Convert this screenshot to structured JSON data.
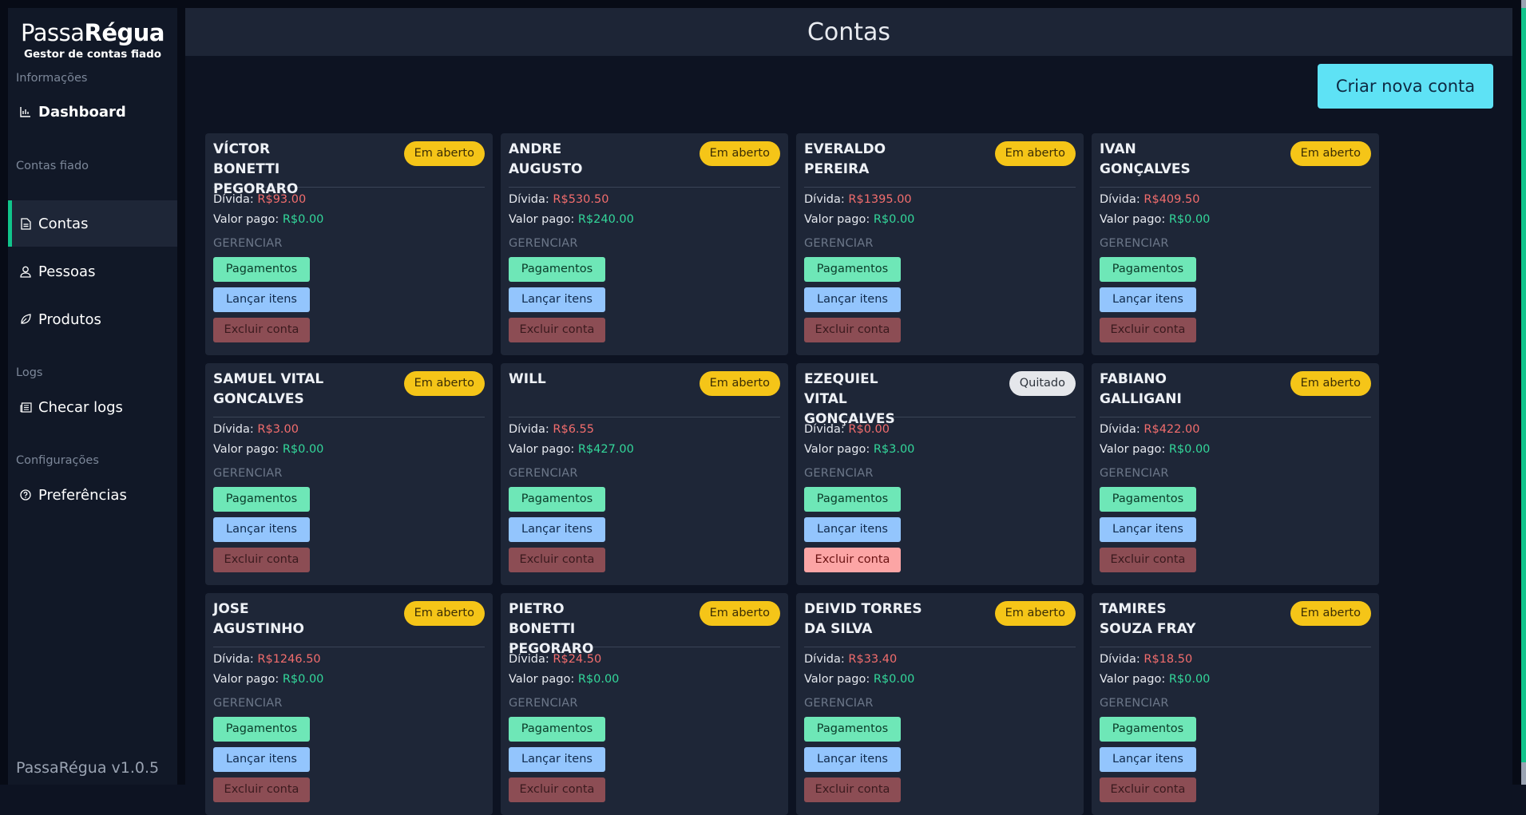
{
  "brand": {
    "title_light": "Passa",
    "title_bold": "Régua",
    "subtitle": "Gestor de contas fiado"
  },
  "sidebar": {
    "sections": [
      {
        "label": "Informações"
      },
      {
        "label": "Contas fiado"
      },
      {
        "label": "Logs"
      },
      {
        "label": "Configurações"
      }
    ],
    "items": [
      {
        "label": "Dashboard",
        "icon": "chart-icon"
      },
      {
        "label": "Contas",
        "icon": "document-icon"
      },
      {
        "label": "Pessoas",
        "icon": "user-icon"
      },
      {
        "label": "Produtos",
        "icon": "leaf-icon"
      },
      {
        "label": "Checar logs",
        "icon": "newspaper-icon"
      },
      {
        "label": "Preferências",
        "icon": "help-circle-icon"
      }
    ],
    "active": "Contas",
    "version": "PassaRégua v1.0.5"
  },
  "header": {
    "title": "Contas"
  },
  "toolbar": {
    "create_label": "Criar nova conta"
  },
  "labels": {
    "debt": "Dívida: ",
    "paid": "Valor pago: ",
    "manage": "GERENCIAR",
    "payments": "Pagamentos",
    "add_items": "Lançar itens",
    "delete": "Excluir conta"
  },
  "accounts": [
    {
      "name": "VÍCTOR BONETTI PEGORARO",
      "status": "Em aberto",
      "debt": "R$93.00",
      "paid": "R$0.00"
    },
    {
      "name": "ANDRE AUGUSTO",
      "status": "Em aberto",
      "debt": "R$530.50",
      "paid": "R$240.00"
    },
    {
      "name": "EVERALDO PEREIRA",
      "status": "Em aberto",
      "debt": "R$1395.00",
      "paid": "R$0.00"
    },
    {
      "name": "IVAN GONÇALVES",
      "status": "Em aberto",
      "debt": "R$409.50",
      "paid": "R$0.00"
    },
    {
      "name": "SAMUEL VITAL GONCALVES",
      "status": "Em aberto",
      "debt": "R$3.00",
      "paid": "R$0.00"
    },
    {
      "name": "WILL",
      "status": "Em aberto",
      "debt": "R$6.55",
      "paid": "R$427.00"
    },
    {
      "name": "EZEQUIEL VITAL GONÇALVES",
      "status": "Quitado",
      "debt": "R$0.00",
      "paid": "R$3.00"
    },
    {
      "name": "FABIANO GALLIGANI",
      "status": "Em aberto",
      "debt": "R$422.00",
      "paid": "R$0.00"
    },
    {
      "name": "JOSE AGUSTINHO",
      "status": "Em aberto",
      "debt": "R$1246.50",
      "paid": "R$0.00"
    },
    {
      "name": "PIETRO BONETTI PEGORARO",
      "status": "Em aberto",
      "debt": "R$24.50",
      "paid": "R$0.00"
    },
    {
      "name": "DEIVID TORRES DA SILVA",
      "status": "Em aberto",
      "debt": "R$33.40",
      "paid": "R$0.00"
    },
    {
      "name": "TAMIRES SOUZA FRAY",
      "status": "Em aberto",
      "debt": "R$18.50",
      "paid": "R$0.00"
    }
  ],
  "colors": {
    "accent": "#10c48b",
    "open_badge": "#f5c518",
    "paid_badge": "#e5e7eb",
    "create_button": "#5ee2f5"
  }
}
